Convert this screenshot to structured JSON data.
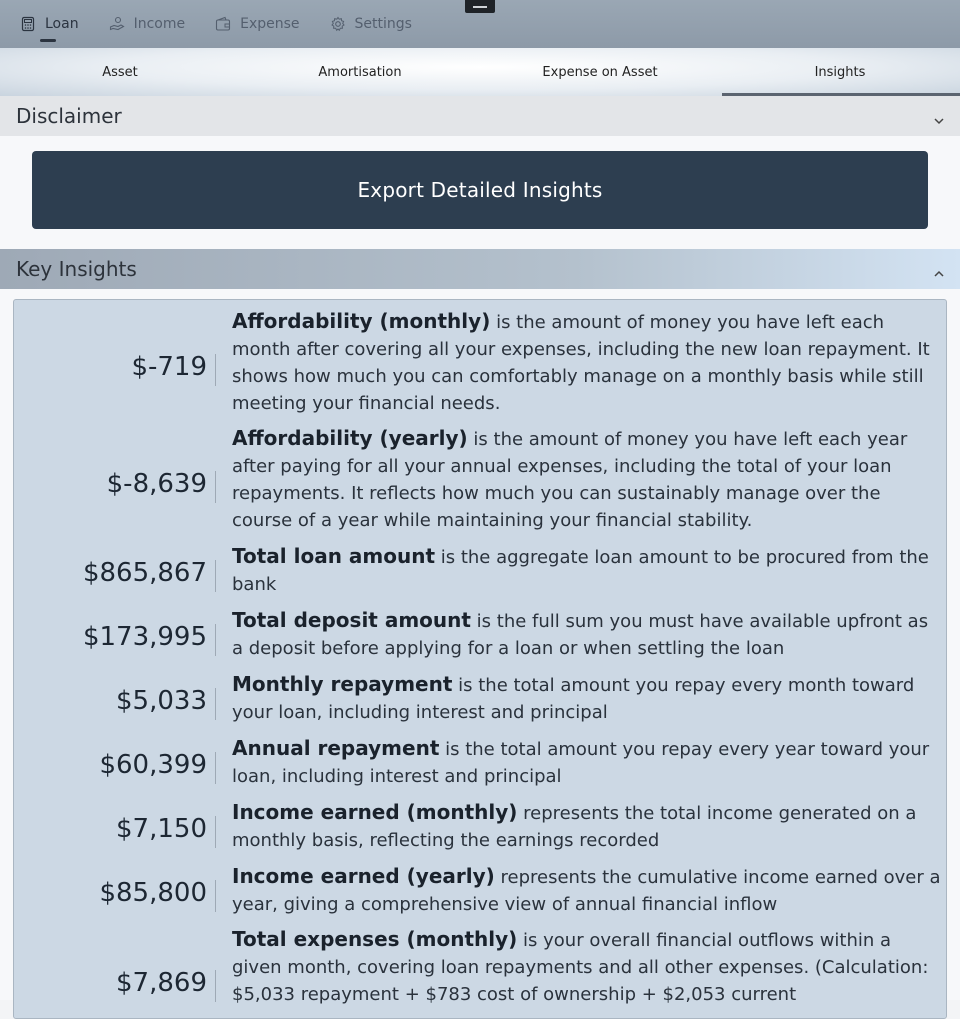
{
  "topnav": {
    "items": [
      {
        "label": "Loan",
        "icon": "calculator-icon"
      },
      {
        "label": "Income",
        "icon": "hand-coin-icon"
      },
      {
        "label": "Expense",
        "icon": "wallet-icon"
      },
      {
        "label": "Settings",
        "icon": "gear-icon"
      }
    ],
    "active": "Loan"
  },
  "tabs": {
    "items": [
      "Asset",
      "Amortisation",
      "Expense on Asset",
      "Insights"
    ],
    "active": "Insights"
  },
  "disclaimer": {
    "title": "Disclaimer"
  },
  "export_button": {
    "label": "Export Detailed Insights"
  },
  "key_insights": {
    "title": "Key Insights",
    "rows": [
      {
        "value": "$-719",
        "term": "Affordability (monthly)",
        "text": " is the amount of money you have left each month after covering all your expenses, including the new loan repayment. It shows how much you can comfortably manage on a monthly basis while still meeting your financial needs."
      },
      {
        "value": "$-8,639",
        "term": "Affordability (yearly)",
        "text": " is the amount of money you have left each year after paying for all your annual expenses, including the total of your loan repayments. It reflects how much you can sustainably manage over the course of a year while maintaining your financial stability."
      },
      {
        "value": "$865,867",
        "term": "Total loan amount",
        "text": " is the aggregate loan amount to be procured from the bank"
      },
      {
        "value": "$173,995",
        "term": "Total deposit amount",
        "text": " is the full sum you must have available upfront as a deposit before applying for a loan or when settling the loan"
      },
      {
        "value": "$5,033",
        "term": "Monthly repayment",
        "text": " is the total amount you repay every month toward your loan, including interest and principal"
      },
      {
        "value": "$60,399",
        "term": "Annual repayment",
        "text": " is the total amount you repay every year toward your loan, including interest and principal"
      },
      {
        "value": "$7,150",
        "term": "Income earned (monthly)",
        "text": " represents the total income generated on a monthly basis, reflecting the earnings recorded"
      },
      {
        "value": "$85,800",
        "term": "Income earned (yearly)",
        "text": " represents the cumulative income earned over a year, giving a comprehensive view of annual financial inflow"
      },
      {
        "value": "$7,869",
        "term": "Total expenses (monthly)",
        "text": " is your overall financial outflows within a given month, covering loan repayments and all other expenses. (Calculation: $5,033 repayment + $783 cost of ownership + $2,053 current"
      }
    ]
  }
}
